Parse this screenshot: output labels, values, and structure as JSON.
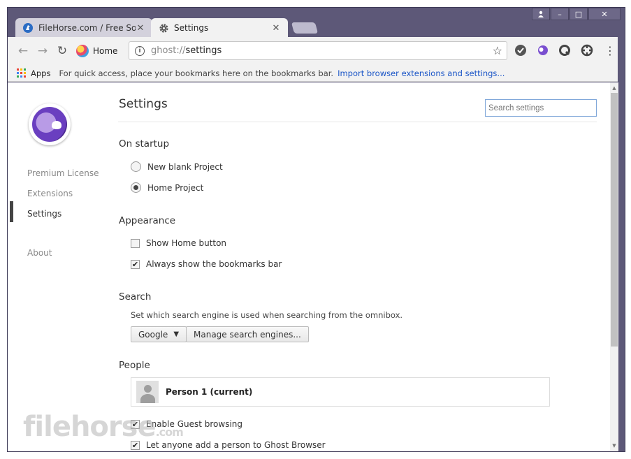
{
  "window": {
    "controls": [
      "person",
      "minimize",
      "maximize",
      "close"
    ]
  },
  "tabs": [
    {
      "title": "FileHorse.com / Free So",
      "icon": "filehorse-icon",
      "active": false
    },
    {
      "title": "Settings",
      "icon": "gear-icon",
      "active": true
    }
  ],
  "toolbar": {
    "home_label": "Home",
    "url_scheme": "ghost://",
    "url_path": "settings"
  },
  "bookmarks": {
    "apps_label": "Apps",
    "hint": "For quick access, place your bookmarks here on the bookmarks bar.",
    "import_link": "Import browser extensions and settings..."
  },
  "sidebar": {
    "items": [
      {
        "label": "Premium License",
        "selected": false
      },
      {
        "label": "Extensions",
        "selected": false
      },
      {
        "label": "Settings",
        "selected": true
      },
      {
        "label": "About",
        "selected": false
      }
    ]
  },
  "settings": {
    "title": "Settings",
    "search_placeholder": "Search settings",
    "startup": {
      "title": "On startup",
      "options": [
        {
          "label": "New blank Project",
          "checked": false
        },
        {
          "label": "Home Project",
          "checked": true
        }
      ]
    },
    "appearance": {
      "title": "Appearance",
      "options": [
        {
          "label": "Show Home button",
          "checked": false
        },
        {
          "label": "Always show the bookmarks bar",
          "checked": true
        }
      ]
    },
    "search": {
      "title": "Search",
      "description": "Set which search engine is used when searching from the omnibox.",
      "engine": "Google",
      "manage_label": "Manage search engines..."
    },
    "people": {
      "title": "People",
      "person": "Person 1 (current)",
      "options": [
        {
          "label": "Enable Guest browsing",
          "checked": true
        },
        {
          "label": "Let anyone add a person to Ghost Browser",
          "checked": true
        }
      ]
    }
  },
  "watermark": {
    "text": "filehorse",
    "suffix": ".com"
  },
  "colors": {
    "window_frame": "#5d5878",
    "link": "#1a55c7",
    "logo_purple": "#6a3fc0"
  }
}
